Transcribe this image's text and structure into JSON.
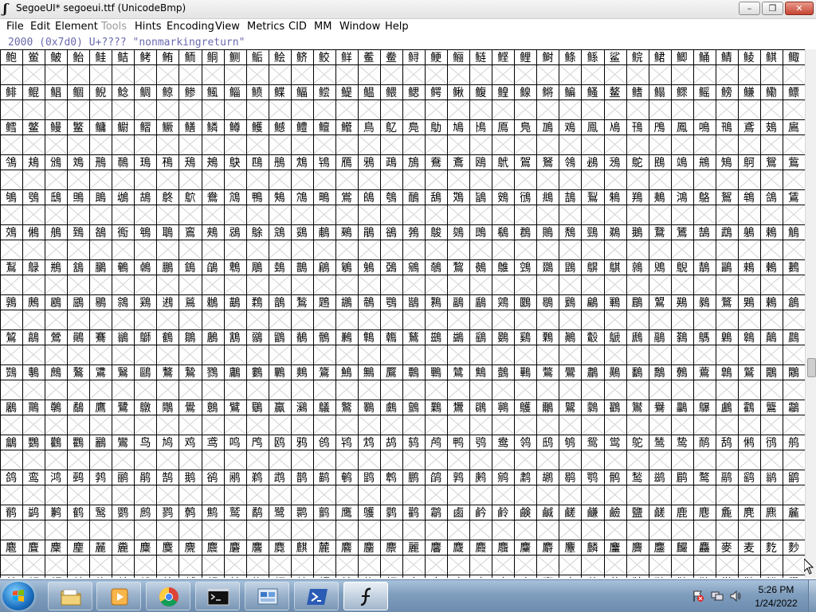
{
  "window": {
    "title": "SegoeUI*  segoeui.ttf (UnicodeBmp)",
    "minimize_label": "–",
    "maximize_label": "❐",
    "close_label": "✕"
  },
  "menu": {
    "items": [
      {
        "label": "File",
        "enabled": true
      },
      {
        "label": "Edit",
        "enabled": true
      },
      {
        "label": "Element",
        "enabled": true
      },
      {
        "label": "Tools",
        "enabled": false
      },
      {
        "label": "Hints",
        "enabled": true
      },
      {
        "label": "Encoding",
        "enabled": true
      },
      {
        "label": "View",
        "enabled": true
      },
      {
        "label": "Metrics",
        "enabled": true
      },
      {
        "label": "CID",
        "enabled": true
      },
      {
        "label": "MM",
        "enabled": true
      },
      {
        "label": "Window",
        "enabled": true
      },
      {
        "label": "Help",
        "enabled": true
      }
    ]
  },
  "glyph_info": "2000 (0x7d0) U+???? \"nonmarkingreturn\"",
  "grid": {
    "columns": 36,
    "glyph_start_codepoint": 40077,
    "glyph_color": "#000000",
    "line_color": "#000000",
    "empty_cell_color": "#d4d4d4",
    "rows": 15,
    "partial_last_row": true
  },
  "taskbar": {
    "start_icon": "windows-logo-icon",
    "apps": [
      {
        "name": "explorer",
        "icon": "folder-icon",
        "active": false
      },
      {
        "name": "media-player",
        "icon": "media-player-icon",
        "active": false
      },
      {
        "name": "chrome",
        "icon": "chrome-icon",
        "active": false
      },
      {
        "name": "terminal",
        "icon": "terminal-icon",
        "active": false
      },
      {
        "name": "control-panel",
        "icon": "control-panel-icon",
        "active": false
      },
      {
        "name": "powershell",
        "icon": "powershell-icon",
        "active": false
      },
      {
        "name": "fontforge",
        "icon": "fontforge-icon",
        "active": true
      }
    ],
    "tray_icons": [
      "action-center-flag-icon",
      "network-icon",
      "volume-icon"
    ],
    "clock": {
      "time": "5:26 PM",
      "date": "1/24/2022"
    }
  },
  "colors": {
    "info_text": "#6a6ab0",
    "close_button": "#c54432",
    "taskbar": "#7f9dbd"
  }
}
